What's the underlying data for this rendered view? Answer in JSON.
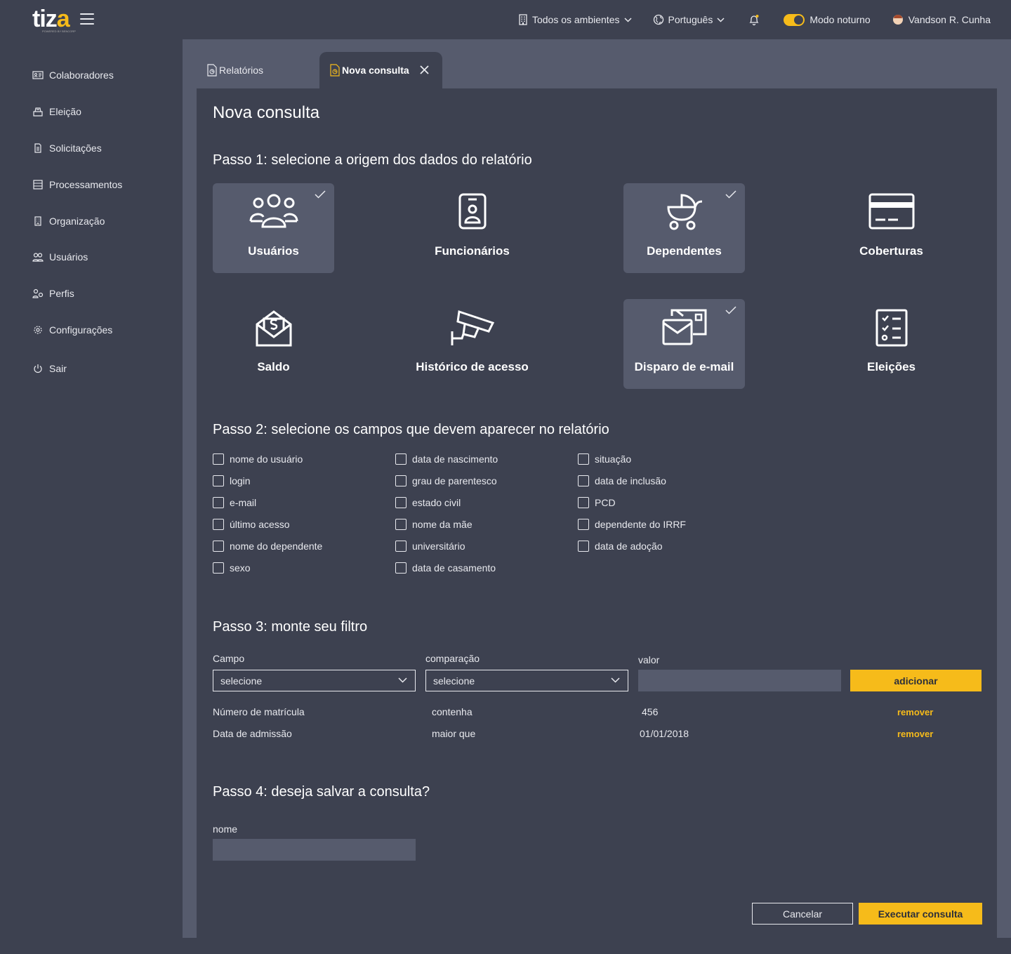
{
  "app": {
    "logo_main": "tiz",
    "logo_accent": "a",
    "logo_sub": "POWERED BY BENCORP"
  },
  "topbar": {
    "environment": "Todos os ambientes",
    "language": "Português",
    "night_mode": "Modo noturno",
    "user": "Vandson R. Cunha"
  },
  "sidebar": {
    "items": [
      {
        "label": "Colaboradores",
        "icon": "id-card-icon"
      },
      {
        "label": "Eleição",
        "icon": "ballot-box-icon"
      },
      {
        "label": "Solicitações",
        "icon": "document-icon"
      },
      {
        "label": "Processamentos",
        "icon": "list-icon"
      },
      {
        "label": "Organização",
        "icon": "building-icon"
      },
      {
        "label": "Usuários",
        "icon": "users-icon"
      },
      {
        "label": "Perfis",
        "icon": "user-gear-icon"
      },
      {
        "label": "Configurações",
        "icon": "gear-icon"
      },
      {
        "label": "Sair",
        "icon": "power-icon"
      }
    ]
  },
  "tabs": [
    {
      "label": "Relatórios",
      "active": false
    },
    {
      "label": "Nova consulta",
      "active": true
    }
  ],
  "page_title": "Nova consulta",
  "step1": {
    "title": "Passo 1: selecione a origem dos dados do relatório",
    "sources": [
      {
        "label": "Usuários",
        "icon": "users-group-icon",
        "selected": true
      },
      {
        "label": "Funcionários",
        "icon": "employee-badge-icon",
        "selected": false
      },
      {
        "label": "Dependentes",
        "icon": "baby-carriage-icon",
        "selected": true
      },
      {
        "label": "Coberturas",
        "icon": "credit-card-icon",
        "selected": false
      },
      {
        "label": "Saldo",
        "icon": "money-envelope-icon",
        "selected": false
      },
      {
        "label": "Histórico de acesso",
        "icon": "security-camera-icon",
        "selected": false
      },
      {
        "label": "Disparo de e-mail",
        "icon": "email-send-icon",
        "selected": true
      },
      {
        "label": "Eleições",
        "icon": "checklist-icon",
        "selected": false
      }
    ]
  },
  "step2": {
    "title": "Passo 2: selecione os campos que devem aparecer no relatório",
    "columns": [
      [
        "nome do usuário",
        "login",
        "e-mail",
        "último acesso",
        "nome do dependente",
        "sexo"
      ],
      [
        "data de nascimento",
        "grau de parentesco",
        "estado civil",
        "nome da mãe",
        "universitário",
        "data de casamento"
      ],
      [
        "situação",
        "data de inclusão",
        "PCD",
        "dependente do IRRF",
        "data de adoção"
      ]
    ]
  },
  "step3": {
    "title": "Passo 3: monte seu filtro",
    "field_label": "Campo",
    "comparison_label": "comparação",
    "value_label": "valor",
    "field_selected": "selecione",
    "comparison_selected": "selecione",
    "value_input": "",
    "add_label": "adicionar",
    "filters": [
      {
        "field": "Número de matrícula",
        "comparison": "contenha",
        "value": "456",
        "remove": "remover"
      },
      {
        "field": "Data de admissão",
        "comparison": "maior que",
        "value": "01/01/2018",
        "remove": "remover"
      }
    ]
  },
  "step4": {
    "title": "Passo 4: deseja salvar a consulta?",
    "name_label": "nome",
    "name_value": ""
  },
  "actions": {
    "cancel": "Cancelar",
    "execute": "Executar consulta"
  },
  "colors": {
    "accent": "#f6bb1a",
    "background": "#3d4150",
    "panel_alt": "#565b6d"
  }
}
